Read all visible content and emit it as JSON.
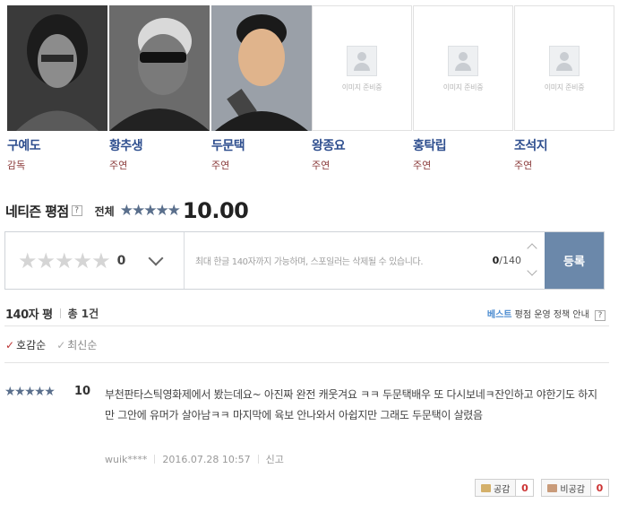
{
  "cast": [
    {
      "name": "구예도",
      "role": "감독",
      "photo": "real"
    },
    {
      "name": "황추생",
      "role": "주연",
      "photo": "real"
    },
    {
      "name": "두문택",
      "role": "주연",
      "photo": "real"
    },
    {
      "name": "왕종요",
      "role": "주연",
      "photo": "placeholder"
    },
    {
      "name": "홍탁립",
      "role": "주연",
      "photo": "placeholder"
    },
    {
      "name": "조석지",
      "role": "주연",
      "photo": "placeholder"
    }
  ],
  "placeholder_text": "이미지 준비중",
  "rating": {
    "title": "네티즌 평점",
    "help": "?",
    "scope": "전체",
    "stars": "★★★★★",
    "score": "10.00"
  },
  "input": {
    "stars": "★★★★★",
    "value": "0",
    "placeholder": "최대 한글 140자까지 가능하며, 스포일러는 삭제될 수 있습니다.",
    "count_current": "0",
    "count_max": "/140",
    "submit_label": "등록"
  },
  "list": {
    "title": "140자 평",
    "total": "총 1건",
    "policy_best": "베스트",
    "policy_rest": " 평점 운영 정책 안내",
    "policy_help": "?"
  },
  "sort": {
    "option_a": "호감순",
    "option_b": "최신순",
    "check": "✓"
  },
  "reviews": [
    {
      "stars": "★★★★★",
      "score": "10",
      "text": "부천판타스틱영화제에서 봤는데요~ 아진짜 완전 캐웃겨요 ㅋㅋ 두문택배우 또 다시보네ㅋ잔인하고 야한기도 하지만 그안에 유머가 살아남ㅋㅋ 마지막에 육보 안나와서 아쉽지만 그래도 두문택이 살렸음",
      "author": "wuik****",
      "date": "2016.07.28 10:57",
      "report": "신고",
      "like_label": "공감",
      "like_count": "0",
      "dislike_label": "비공감",
      "dislike_count": "0"
    }
  ]
}
